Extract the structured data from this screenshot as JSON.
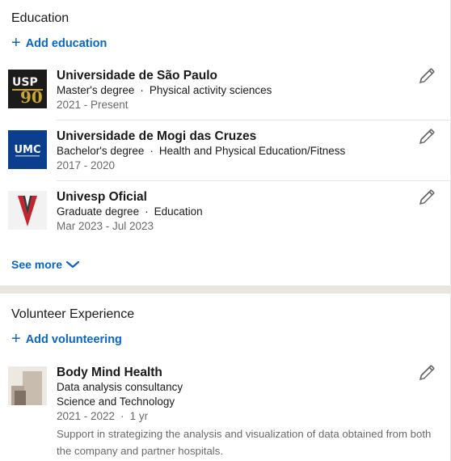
{
  "education": {
    "title": "Education",
    "add_label": "Add education",
    "see_more_label": "See more",
    "items": [
      {
        "school": "Universidade de São Paulo",
        "degree": "Master's degree",
        "field": "Physical activity sciences",
        "dates": "2021 - Present",
        "logo_text": "USP",
        "logo_sub": "90"
      },
      {
        "school": "Universidade de Mogi das Cruzes",
        "degree": "Bachelor's degree",
        "field": "Health and Physical Education/Fitness",
        "dates": "2017 - 2020",
        "logo_text": "UMC"
      },
      {
        "school": "Univesp Oficial",
        "degree": "Graduate degree",
        "field": "Education",
        "dates": "Mar 2023 - Jul 2023"
      }
    ]
  },
  "volunteer": {
    "title": "Volunteer Experience",
    "add_label": "Add volunteering",
    "items": [
      {
        "organization": "Body Mind Health",
        "role": "Data analysis consultancy",
        "cause": "Science and Technology",
        "dates": "2021 - 2022",
        "duration": "1 yr",
        "description": "Support in strategizing the analysis and visualization of data obtained from both the company and partner hospitals."
      }
    ]
  },
  "colors": {
    "link": "#0a66c2",
    "umc_blue": "#0b3e8c",
    "univesp_red": "#c8232c",
    "divider": "#e9e5df"
  },
  "icons": {
    "edit": "pencil-icon",
    "add": "plus-icon",
    "see_more": "chevron-down-icon"
  }
}
